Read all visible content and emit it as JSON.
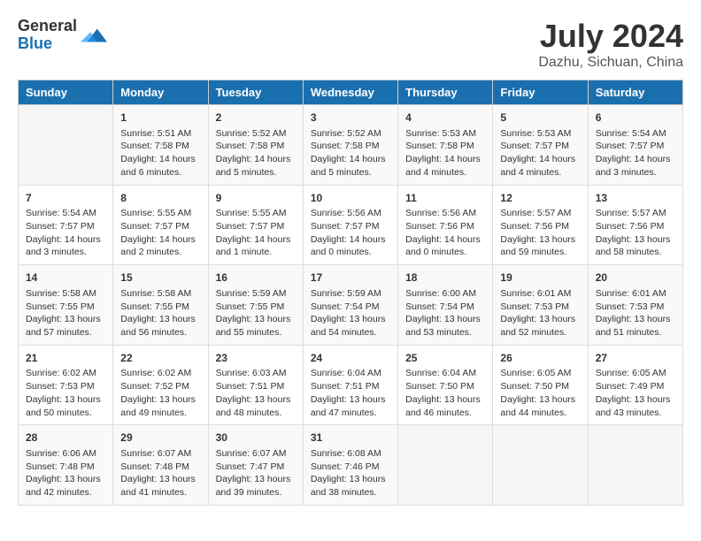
{
  "logo": {
    "general": "General",
    "blue": "Blue"
  },
  "title": "July 2024",
  "location": "Dazhu, Sichuan, China",
  "days_of_week": [
    "Sunday",
    "Monday",
    "Tuesday",
    "Wednesday",
    "Thursday",
    "Friday",
    "Saturday"
  ],
  "weeks": [
    [
      {
        "day": "",
        "info": ""
      },
      {
        "day": "1",
        "info": "Sunrise: 5:51 AM\nSunset: 7:58 PM\nDaylight: 14 hours\nand 6 minutes."
      },
      {
        "day": "2",
        "info": "Sunrise: 5:52 AM\nSunset: 7:58 PM\nDaylight: 14 hours\nand 5 minutes."
      },
      {
        "day": "3",
        "info": "Sunrise: 5:52 AM\nSunset: 7:58 PM\nDaylight: 14 hours\nand 5 minutes."
      },
      {
        "day": "4",
        "info": "Sunrise: 5:53 AM\nSunset: 7:58 PM\nDaylight: 14 hours\nand 4 minutes."
      },
      {
        "day": "5",
        "info": "Sunrise: 5:53 AM\nSunset: 7:57 PM\nDaylight: 14 hours\nand 4 minutes."
      },
      {
        "day": "6",
        "info": "Sunrise: 5:54 AM\nSunset: 7:57 PM\nDaylight: 14 hours\nand 3 minutes."
      }
    ],
    [
      {
        "day": "7",
        "info": "Sunrise: 5:54 AM\nSunset: 7:57 PM\nDaylight: 14 hours\nand 3 minutes."
      },
      {
        "day": "8",
        "info": "Sunrise: 5:55 AM\nSunset: 7:57 PM\nDaylight: 14 hours\nand 2 minutes."
      },
      {
        "day": "9",
        "info": "Sunrise: 5:55 AM\nSunset: 7:57 PM\nDaylight: 14 hours\nand 1 minute."
      },
      {
        "day": "10",
        "info": "Sunrise: 5:56 AM\nSunset: 7:57 PM\nDaylight: 14 hours\nand 0 minutes."
      },
      {
        "day": "11",
        "info": "Sunrise: 5:56 AM\nSunset: 7:56 PM\nDaylight: 14 hours\nand 0 minutes."
      },
      {
        "day": "12",
        "info": "Sunrise: 5:57 AM\nSunset: 7:56 PM\nDaylight: 13 hours\nand 59 minutes."
      },
      {
        "day": "13",
        "info": "Sunrise: 5:57 AM\nSunset: 7:56 PM\nDaylight: 13 hours\nand 58 minutes."
      }
    ],
    [
      {
        "day": "14",
        "info": "Sunrise: 5:58 AM\nSunset: 7:55 PM\nDaylight: 13 hours\nand 57 minutes."
      },
      {
        "day": "15",
        "info": "Sunrise: 5:58 AM\nSunset: 7:55 PM\nDaylight: 13 hours\nand 56 minutes."
      },
      {
        "day": "16",
        "info": "Sunrise: 5:59 AM\nSunset: 7:55 PM\nDaylight: 13 hours\nand 55 minutes."
      },
      {
        "day": "17",
        "info": "Sunrise: 5:59 AM\nSunset: 7:54 PM\nDaylight: 13 hours\nand 54 minutes."
      },
      {
        "day": "18",
        "info": "Sunrise: 6:00 AM\nSunset: 7:54 PM\nDaylight: 13 hours\nand 53 minutes."
      },
      {
        "day": "19",
        "info": "Sunrise: 6:01 AM\nSunset: 7:53 PM\nDaylight: 13 hours\nand 52 minutes."
      },
      {
        "day": "20",
        "info": "Sunrise: 6:01 AM\nSunset: 7:53 PM\nDaylight: 13 hours\nand 51 minutes."
      }
    ],
    [
      {
        "day": "21",
        "info": "Sunrise: 6:02 AM\nSunset: 7:53 PM\nDaylight: 13 hours\nand 50 minutes."
      },
      {
        "day": "22",
        "info": "Sunrise: 6:02 AM\nSunset: 7:52 PM\nDaylight: 13 hours\nand 49 minutes."
      },
      {
        "day": "23",
        "info": "Sunrise: 6:03 AM\nSunset: 7:51 PM\nDaylight: 13 hours\nand 48 minutes."
      },
      {
        "day": "24",
        "info": "Sunrise: 6:04 AM\nSunset: 7:51 PM\nDaylight: 13 hours\nand 47 minutes."
      },
      {
        "day": "25",
        "info": "Sunrise: 6:04 AM\nSunset: 7:50 PM\nDaylight: 13 hours\nand 46 minutes."
      },
      {
        "day": "26",
        "info": "Sunrise: 6:05 AM\nSunset: 7:50 PM\nDaylight: 13 hours\nand 44 minutes."
      },
      {
        "day": "27",
        "info": "Sunrise: 6:05 AM\nSunset: 7:49 PM\nDaylight: 13 hours\nand 43 minutes."
      }
    ],
    [
      {
        "day": "28",
        "info": "Sunrise: 6:06 AM\nSunset: 7:48 PM\nDaylight: 13 hours\nand 42 minutes."
      },
      {
        "day": "29",
        "info": "Sunrise: 6:07 AM\nSunset: 7:48 PM\nDaylight: 13 hours\nand 41 minutes."
      },
      {
        "day": "30",
        "info": "Sunrise: 6:07 AM\nSunset: 7:47 PM\nDaylight: 13 hours\nand 39 minutes."
      },
      {
        "day": "31",
        "info": "Sunrise: 6:08 AM\nSunset: 7:46 PM\nDaylight: 13 hours\nand 38 minutes."
      },
      {
        "day": "",
        "info": ""
      },
      {
        "day": "",
        "info": ""
      },
      {
        "day": "",
        "info": ""
      }
    ]
  ]
}
